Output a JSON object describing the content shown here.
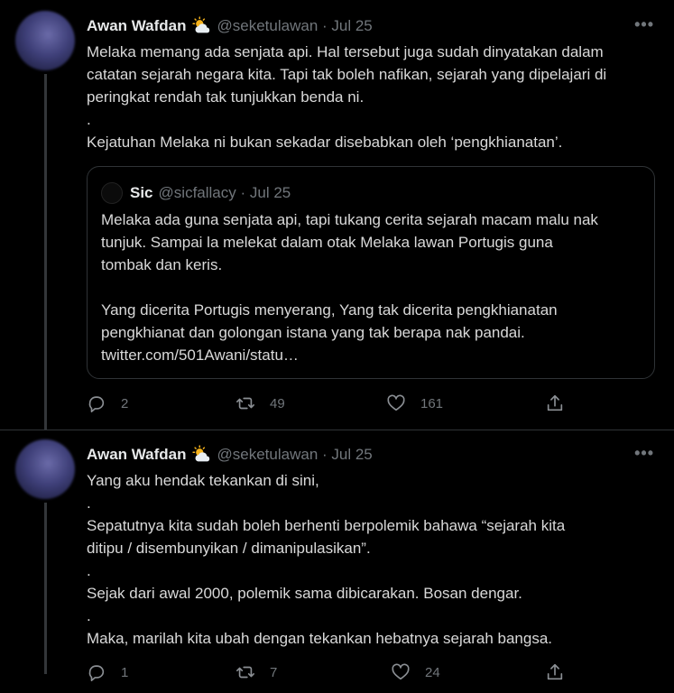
{
  "tweets": [
    {
      "author": "Awan Wafdan",
      "weather_icon": "sun-behind-cloud-icon",
      "meta": "@seketulawan · Jul 25",
      "more_label": "•••",
      "lines": [
        "Melaka memang ada senjata api. Hal tersebut juga sudah dinyatakan dalam",
        "catatan sejarah negara kita. Tapi tak boleh nafikan, sejarah yang dipelajari di",
        "peringkat rendah tak tunjukkan benda ni.",
        ".",
        "Kejatuhan Melaka ni bukan sekadar disebabkan oleh ‘pengkhianatan’."
      ],
      "quote": {
        "author": "Sic",
        "meta": "@sicfallacy · Jul 25",
        "lines": [
          "Melaka ada guna senjata api, tapi tukang cerita sejarah macam malu nak",
          "tunjuk. Sampai la melekat dalam otak Melaka lawan Portugis guna",
          "tombak dan keris.",
          " ",
          "Yang dicerita Portugis menyerang, Yang tak dicerita pengkhianatan",
          "pengkhianat dan golongan istana yang tak berapa nak pandai.",
          "twitter.com/501Awani/statu…"
        ]
      },
      "reply_count": "2",
      "retweet_count": "49",
      "like_count": "161"
    },
    {
      "author": "Awan Wafdan",
      "weather_icon": "sun-behind-cloud-icon",
      "meta": "@seketulawan · Jul 25",
      "more_label": "•••",
      "lines": [
        "Yang aku hendak tekankan di sini,",
        ".",
        "Sepatutnya kita sudah boleh berhenti berpolemik bahawa “sejarah kita",
        "ditipu / disembunyikan / dimanipulasikan”.",
        ".",
        "Sejak dari awal 2000, polemik sama dibicarakan. Bosan dengar.",
        ".",
        "Maka, marilah kita ubah dengan tekankan hebatnya sejarah bangsa."
      ],
      "reply_count": "1",
      "retweet_count": "7",
      "like_count": "24"
    }
  ]
}
